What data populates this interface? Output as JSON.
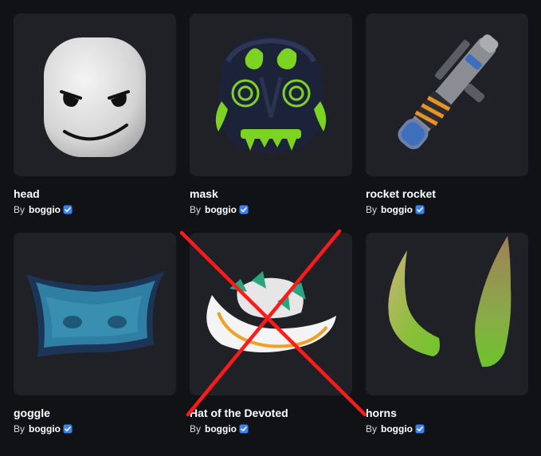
{
  "items": [
    {
      "name": "head",
      "by": "By",
      "creator": "boggio",
      "icon": "head-thumbnail",
      "verified_icon": "verified-badge-icon"
    },
    {
      "name": "mask",
      "by": "By",
      "creator": "boggio",
      "icon": "mask-thumbnail",
      "verified_icon": "verified-badge-icon"
    },
    {
      "name": "rocket rocket",
      "by": "By",
      "creator": "boggio",
      "icon": "rocket-launcher-thumbnail",
      "verified_icon": "verified-badge-icon"
    },
    {
      "name": "goggle",
      "by": "By",
      "creator": "boggio",
      "icon": "goggle-thumbnail",
      "verified_icon": "verified-badge-icon"
    },
    {
      "name": "Hat of the Devoted",
      "by": "By",
      "creator": "boggio",
      "icon": "hat-thumbnail",
      "verified_icon": "verified-badge-icon"
    },
    {
      "name": "horns",
      "by": "By",
      "creator": "boggio",
      "icon": "horns-thumbnail",
      "verified_icon": "verified-badge-icon"
    }
  ],
  "colors": {
    "background": "#111216",
    "card": "#1f2127",
    "verified": "#3b82f6",
    "cross_mark": "#ff1a1a"
  },
  "annotation": {
    "icon": "red-x-mark",
    "target": "Hat of the Devoted"
  }
}
